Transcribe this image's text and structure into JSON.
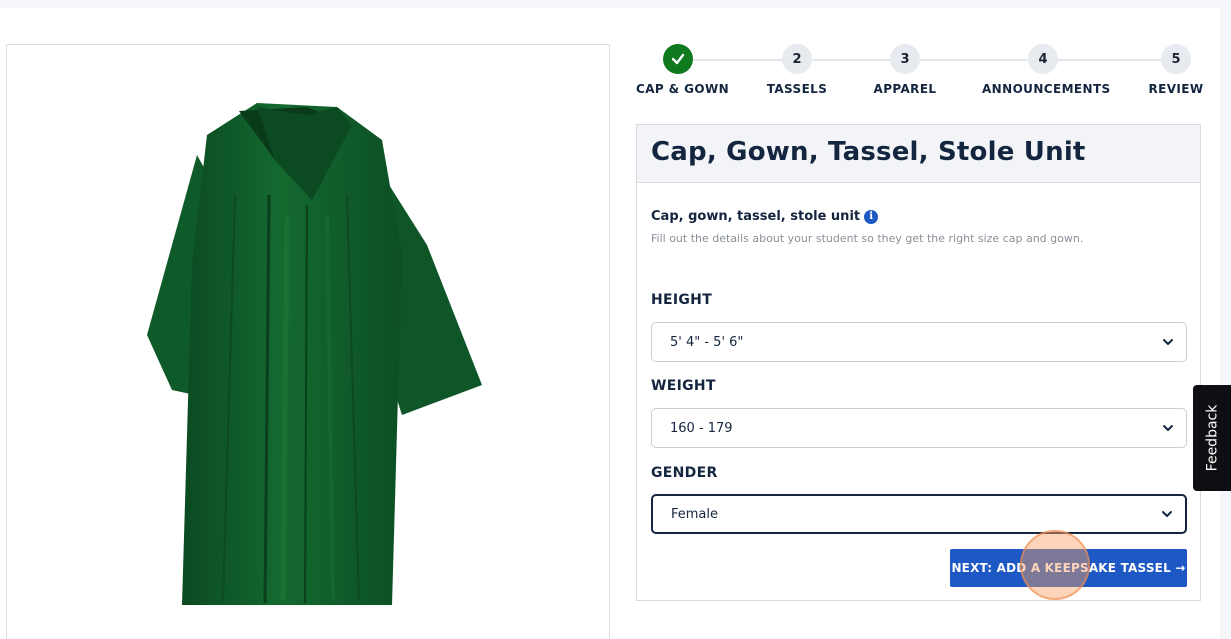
{
  "steps": [
    {
      "number": "",
      "label": "CAP & GOWN",
      "completed": true
    },
    {
      "number": "2",
      "label": "TASSELS",
      "completed": false
    },
    {
      "number": "3",
      "label": "APPAREL",
      "completed": false
    },
    {
      "number": "4",
      "label": "ANNOUNCEMENTS",
      "completed": false
    },
    {
      "number": "5",
      "label": "REVIEW",
      "completed": false
    }
  ],
  "card": {
    "title": "Cap, Gown, Tassel, Stole Unit",
    "unit_title": "Cap, gown, tassel, stole unit",
    "unit_description": "Fill out the details about your student so they get the right size cap and gown."
  },
  "form": {
    "height_label": "HEIGHT",
    "height_value": "5' 4\" - 5' 6\"",
    "weight_label": "WEIGHT",
    "weight_value": "160 - 179",
    "gender_label": "GENDER",
    "gender_value": "Female"
  },
  "next_button_label": "NEXT: ADD A KEEPSAKE TASSEL →",
  "feedback_label": "Feedback",
  "colors": {
    "accent_blue": "#1d58c4",
    "success_green": "#0f7a1d",
    "gown_green": "#0e5a2a",
    "text_navy": "#14263f"
  }
}
